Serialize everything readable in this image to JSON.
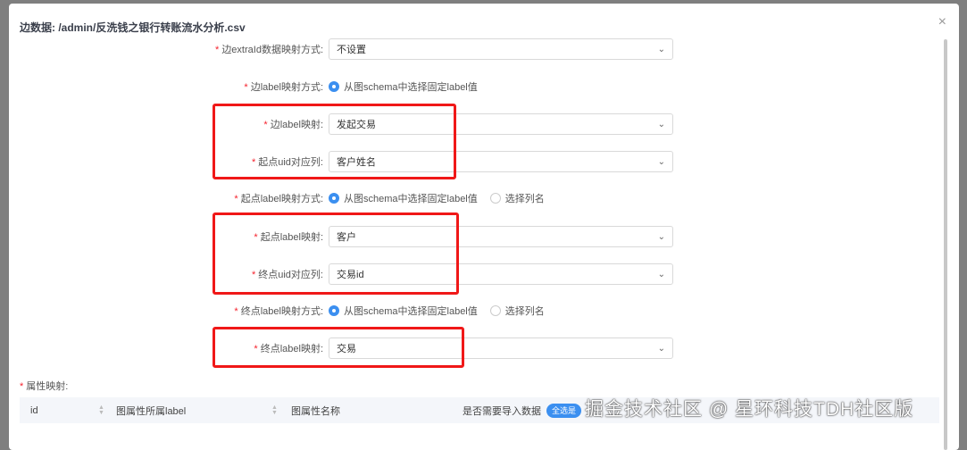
{
  "modal": {
    "title": "边数据: /admin/反洗钱之银行转账流水分析.csv",
    "close": "×"
  },
  "form": {
    "required_mark": "*",
    "extraid": {
      "label": "边extraId数据映射方式:",
      "value": "不设置"
    },
    "edge_label_mode": {
      "label": "边label映射方式:",
      "options": [
        "从图schema中选择固定label值"
      ]
    },
    "edge_label": {
      "label": "边label映射:",
      "value": "发起交易"
    },
    "src_uid": {
      "label": "起点uid对应列:",
      "value": "客户姓名"
    },
    "src_label_mode": {
      "label": "起点label映射方式:",
      "options": [
        "从图schema中选择固定label值",
        "选择列名"
      ]
    },
    "src_label": {
      "label": "起点label映射:",
      "value": "客户"
    },
    "dst_uid": {
      "label": "终点uid对应列:",
      "value": "交易id"
    },
    "dst_label_mode": {
      "label": "终点label映射方式:",
      "options": [
        "从图schema中选择固定label值",
        "选择列名"
      ]
    },
    "dst_label": {
      "label": "终点label映射:",
      "value": "交易"
    }
  },
  "attr": {
    "label": "属性映射:",
    "columns": [
      "id",
      "图属性所属label",
      "图属性名称",
      "是否需要导入数据"
    ],
    "toggle": "全选是"
  },
  "watermark": "掘金技术社区 @ 星环科技TDH社区版"
}
